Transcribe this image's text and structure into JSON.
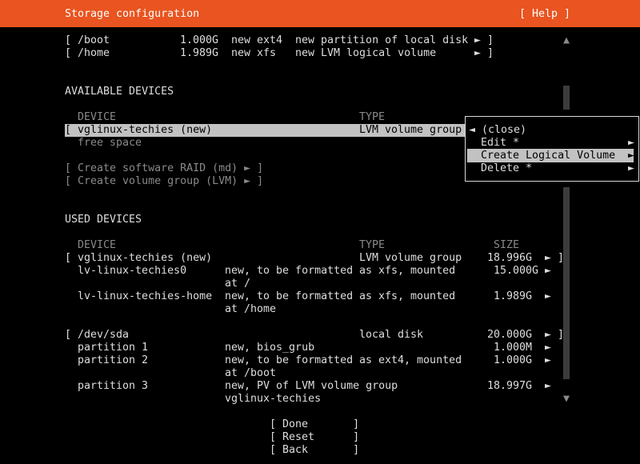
{
  "header": {
    "title": "Storage configuration",
    "help": "[ Help ]"
  },
  "top_rows": [
    {
      "open": "[",
      "path": "/boot",
      "size": "1.000G",
      "fmt": "new ext4",
      "desc": "new partition of local disk",
      "arrow": "►",
      "close": "]"
    },
    {
      "open": "[",
      "path": "/home",
      "size": "1.989G",
      "fmt": "new xfs",
      "desc": "new LVM logical volume",
      "arrow": "►",
      "close": "]"
    }
  ],
  "available": {
    "heading": "AVAILABLE DEVICES",
    "col_device": "DEVICE",
    "col_type": "TYPE",
    "device_row": {
      "open": "[",
      "name": "vglinux-techies (new)",
      "type": "LVM volume group"
    },
    "free_space": "free space",
    "raid_button": "[ Create software RAID (md) ► ]",
    "vg_button": "[ Create volume group (LVM) ► ]"
  },
  "menu": {
    "close": "◄ (close)",
    "edit": "Edit *",
    "create_lv": "Create Logical Volume",
    "delete": "Delete *",
    "arrow": "►"
  },
  "used": {
    "heading": "USED DEVICES",
    "col_device": "DEVICE",
    "col_type": "TYPE",
    "col_size": "SIZE",
    "rows": [
      {
        "open": "[",
        "name": "vglinux-techies (new)",
        "type": "LVM volume group",
        "size": "18.996G",
        "arrow": "►",
        "close": "]"
      },
      {
        "name": "lv-linux-techies0",
        "desc1": "new, to be formatted",
        "type1": "as xfs, mounted",
        "desc2": "at /",
        "size": "15.000G",
        "arrow": "►"
      },
      {
        "name": "lv-linux-techies-home",
        "desc1": "new, to be formatted",
        "type1": "as xfs, mounted",
        "desc2": "at /home",
        "size": "1.989G",
        "arrow": "►"
      },
      {
        "open": "[",
        "name": "/dev/sda",
        "type": "local disk",
        "size": "20.000G",
        "arrow": "►",
        "close": "]"
      },
      {
        "name": "partition 1",
        "desc1": "new, bios_grub",
        "size": "1.000M",
        "arrow": "►"
      },
      {
        "name": "partition 2",
        "desc1": "new, to be formatted",
        "type1": "as ext4, mounted",
        "desc2": "at /boot",
        "size": "1.000G",
        "arrow": "►"
      },
      {
        "name": "partition 3",
        "desc1": "new, PV of LVM volume group",
        "desc2": "vglinux-techies",
        "size": "18.997G",
        "arrow": "►"
      }
    ]
  },
  "buttons": {
    "done": "[ Done       ]",
    "reset": "[ Reset      ]",
    "back": "[ Back       ]"
  },
  "scroll": {
    "up": "▲",
    "down": "▼"
  },
  "colors": {
    "header_bg": "#e95420",
    "selected_bg": "#c2c2c2",
    "background": "#000000"
  }
}
